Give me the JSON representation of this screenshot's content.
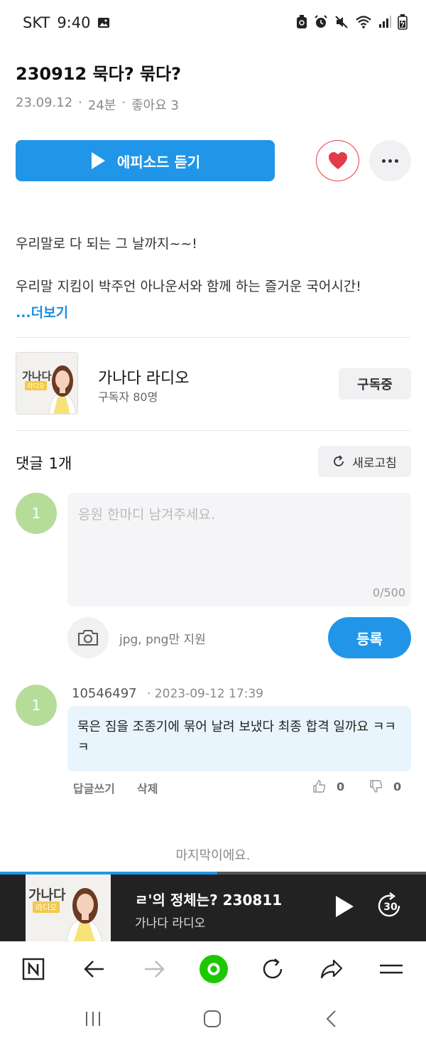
{
  "status_bar": {
    "carrier": "SKT",
    "time": "9:40"
  },
  "episode": {
    "title": "230912 묵다? 묶다?",
    "date": "23.09.12",
    "duration": "24분",
    "likes_label": "좋아요 3",
    "listen_label": "에피소드 듣기",
    "description_line1": "우리말로 다 되는 그 날까지~~!",
    "description_line2": "우리말 지킴이 박주언 아나운서와 함께 하는 즐거운 국어시간!",
    "more_label": "...더보기"
  },
  "channel": {
    "name": "가나다 라디오",
    "subscribers": "구독자 80명",
    "subscribe_label": "구독중",
    "thumb_title": "가나다",
    "thumb_sub": "라디오"
  },
  "comments": {
    "title": "댓글",
    "count": "1개",
    "refresh_label": "새로고침",
    "my_avatar": "1",
    "placeholder": "응원 한마디 남겨주세요.",
    "char_count": "0/500",
    "upload_hint": "jpg, png만 지원",
    "submit_label": "등록",
    "items": [
      {
        "avatar": "1",
        "author": "10546497",
        "date": "· 2023-09-12 17:39",
        "text": "묵은 짐을 조종기에 묶어 날려 보냈다 최종 합격 일까요 ㅋㅋㅋ",
        "reply_label": "답글쓰기",
        "delete_label": "삭제",
        "likes": "0",
        "dislikes": "0"
      }
    ],
    "end_label": "마지막이에요."
  },
  "player": {
    "title": "ㄹ'의 정체는?     230811",
    "subtitle": "가나다 라디오",
    "progress": 0.51,
    "skip_seconds": "30"
  },
  "colors": {
    "accent": "#2196e8",
    "like_red": "#e23b4a",
    "avatar_green": "#b6dc9a",
    "player_bg": "#222222",
    "naver_green": "#1ec800"
  },
  "icons": {
    "browser_bar": [
      "naver-n-icon",
      "back-arrow-icon",
      "forward-arrow-icon",
      "naver-home-icon",
      "reload-icon",
      "share-icon",
      "menu-icon"
    ],
    "system_nav": [
      "recent-apps-icon",
      "home-icon",
      "back-icon"
    ]
  }
}
